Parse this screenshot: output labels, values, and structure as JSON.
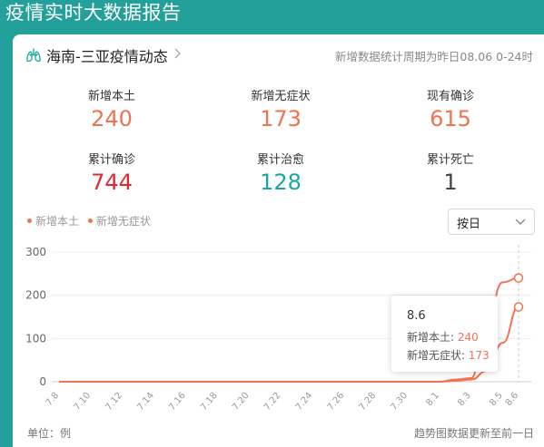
{
  "header": {
    "title": "疫情实时大数据报告"
  },
  "panel": {
    "title": "海南-三亚疫情动态",
    "period": "新增数据统计周期为昨日08.06 0-24时"
  },
  "stats": [
    {
      "label": "新增本土",
      "value": "240",
      "color": "#f07351"
    },
    {
      "label": "新增无症状",
      "value": "173",
      "color": "#f07351"
    },
    {
      "label": "现有确诊",
      "value": "615",
      "color": "#f07351"
    },
    {
      "label": "累计确诊",
      "value": "744",
      "color": "#e0282e"
    },
    {
      "label": "累计治愈",
      "value": "128",
      "color": "#1aa6a6"
    },
    {
      "label": "累计死亡",
      "value": "1",
      "color": "#444444"
    }
  ],
  "legend": [
    {
      "label": "新增本土"
    },
    {
      "label": "新增无症状"
    }
  ],
  "range_select": {
    "value": "按日"
  },
  "icons": {
    "panel": "lungs-icon",
    "more": "chevron-right-icon",
    "select": "chevron-down-icon"
  },
  "colors": {
    "accent": "#f07351",
    "header_bg": "#23a09a"
  },
  "chart_data": {
    "type": "line",
    "x": [
      "7.8",
      "7.9",
      "7.10",
      "7.11",
      "7.12",
      "7.13",
      "7.14",
      "7.15",
      "7.16",
      "7.17",
      "7.18",
      "7.19",
      "7.20",
      "7.21",
      "7.22",
      "7.23",
      "7.24",
      "7.25",
      "7.26",
      "7.27",
      "7.28",
      "7.29",
      "7.30",
      "7.31",
      "8.1",
      "8.2",
      "8.3",
      "8.4",
      "8.5",
      "8.6"
    ],
    "tick_labels": [
      "7.8",
      "7.10",
      "7.12",
      "7.14",
      "7.16",
      "7.18",
      "7.20",
      "7.22",
      "7.24",
      "7.26",
      "7.28",
      "7.30",
      "8.1",
      "8.3",
      "8.5",
      "8.6"
    ],
    "series": [
      {
        "name": "新增本土",
        "values": [
          0,
          0,
          0,
          0,
          0,
          0,
          0,
          0,
          0,
          0,
          0,
          0,
          0,
          0,
          0,
          0,
          0,
          0,
          0,
          0,
          0,
          0,
          0,
          0,
          0,
          5,
          8,
          140,
          230,
          240
        ]
      },
      {
        "name": "新增无症状",
        "values": [
          0,
          0,
          0,
          0,
          0,
          0,
          0,
          0,
          0,
          0,
          0,
          0,
          0,
          0,
          0,
          0,
          0,
          0,
          0,
          0,
          0,
          0,
          0,
          0,
          0,
          2,
          5,
          25,
          90,
          173
        ]
      }
    ],
    "yticks": [
      0,
      100,
      200,
      300
    ],
    "ylim": [
      0,
      300
    ],
    "grid": true,
    "tooltip": {
      "date": "8.6",
      "rows": [
        {
          "label": "新增本土:",
          "value": "240"
        },
        {
          "label": "新增无症状:",
          "value": "173"
        }
      ]
    }
  },
  "footer": {
    "unit": "单位：例",
    "note": "趋势图数据更新至前一日"
  }
}
